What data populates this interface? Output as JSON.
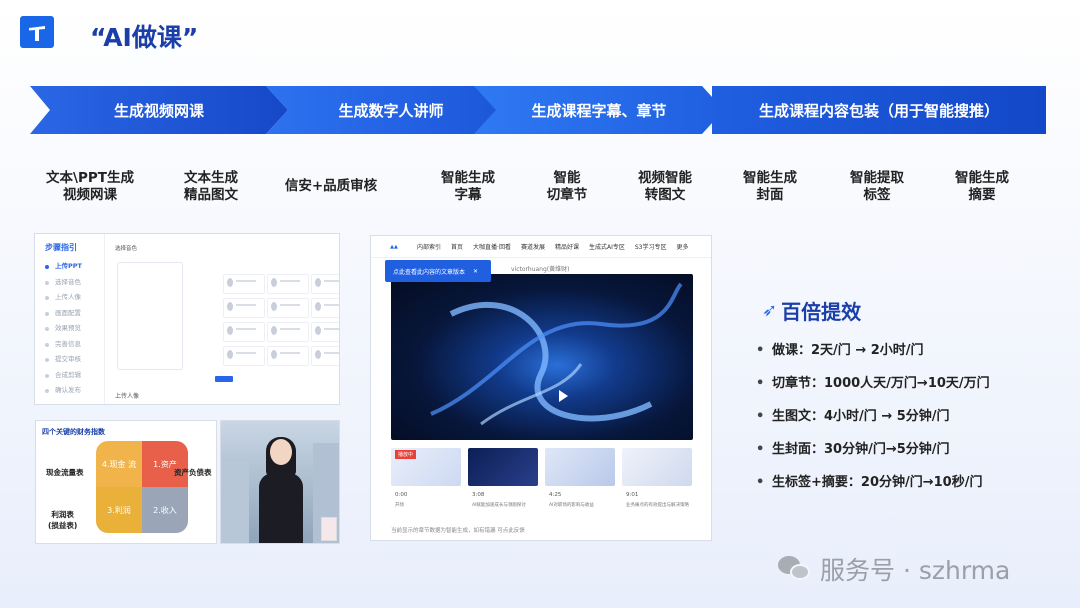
{
  "header": {
    "title": "“AI做课”"
  },
  "banner": [
    {
      "label": "生成视频网课"
    },
    {
      "label": "生成数字人讲师"
    },
    {
      "label": "生成课程字幕、章节"
    },
    {
      "label": "生成课程内容包装（用于智能搜推）"
    }
  ],
  "features": [
    {
      "line1": "文本\\PPT生成",
      "line2": "视频网课"
    },
    {
      "line1": "文本生成",
      "line2": "精品图文"
    },
    {
      "line1": "信安+品质审核",
      "line2": ""
    },
    {
      "line1": "智能生成",
      "line2": "字幕"
    },
    {
      "line1": "智能",
      "line2": "切章节"
    },
    {
      "line1": "视频智能",
      "line2": "转图文"
    },
    {
      "line1": "智能生成",
      "line2": "封面"
    },
    {
      "line1": "智能提取",
      "line2": "标签"
    },
    {
      "line1": "智能生成",
      "line2": "摘要"
    }
  ],
  "steps_panel": {
    "title": "步骤指引",
    "steps": [
      "上传PPT",
      "选择音色",
      "上传人像",
      "画面配置",
      "效果预览",
      "完善信息",
      "提交审核",
      "合成剪辑",
      "确认发布"
    ],
    "footer": "上传人像",
    "section_label": "选择音色"
  },
  "finance_panel": {
    "title": "四个关键的财务指数",
    "labels": [
      "现金流量表",
      "资产负债表",
      "利润表\n(损益表)"
    ],
    "quadrants": [
      "4.现金\n流",
      "1.资产",
      "3.利润",
      "2.收入"
    ]
  },
  "video_panel": {
    "nav": [
      "内部索引",
      "首页",
      "大咖直播·回看",
      "赛道发展",
      "精品好课",
      "生成式AI专区",
      "S3学习专区",
      "更多"
    ],
    "popup": "点此查看此内容的文章版本",
    "author": "victorhuang(黄维财)",
    "thumbs": [
      {
        "time": "0:00",
        "label": "开场",
        "badge": "播放中"
      },
      {
        "time": "3:08",
        "label": "AI赋能加速成长与领跑探讨"
      },
      {
        "time": "4:25",
        "label": "AI对职场的影响与收益"
      },
      {
        "time": "9:01",
        "label": "业务痛点的有效提出与解决策略"
      }
    ],
    "footer": "当前显示的章节数据为智能生成，如有错漏 可点此反馈"
  },
  "efficiency": {
    "title": "百倍提效",
    "items": [
      "做课：2天/门 → 2小时/门",
      "切章节：1000人天/万门→10天/万门",
      "生图文：4小时/门 → 5分钟/门",
      "生封面：30分钟/门→5分钟/门",
      "生标签+摘要：20分钟/门→10秒/门"
    ]
  },
  "watermark": {
    "text": "服务号 · szhrma"
  },
  "colors": {
    "brand": "#1a66e8",
    "title": "#1a3fa8",
    "banner": "#2a67e6"
  }
}
